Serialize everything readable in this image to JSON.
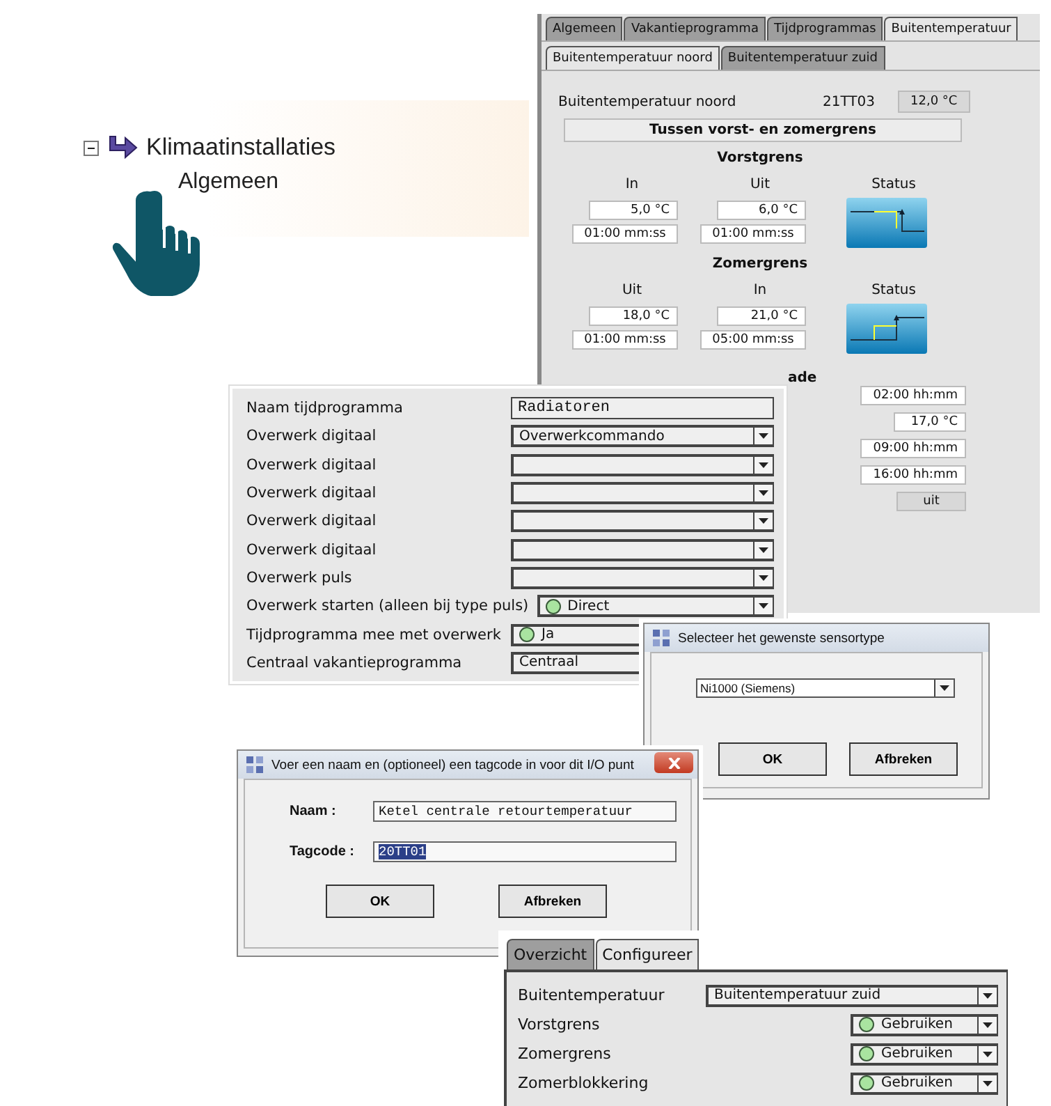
{
  "tree": {
    "items": [
      {
        "label": "Klimaatinstallaties",
        "expanded": true,
        "children": [
          {
            "label": "Algemeen"
          }
        ]
      }
    ]
  },
  "outdoor_panel": {
    "tabs": [
      {
        "label": "Algemeen",
        "selected": false
      },
      {
        "label": "Vakantieprogramma",
        "selected": false
      },
      {
        "label": "Tijdprogrammas",
        "selected": false
      },
      {
        "label": "Buitentemperatuur",
        "selected": true
      }
    ],
    "subtabs": [
      {
        "label": "Buitentemperatuur noord",
        "selected": true
      },
      {
        "label": "Buitentemperatuur zuid",
        "selected": false
      }
    ],
    "sensor": {
      "label": "Buitentemperatuur noord",
      "tag": "21TT03",
      "value": "12,0 °C"
    },
    "state": "Tussen vorst- en zomergrens",
    "sections": [
      {
        "title": "Vorstgrens",
        "status": {
          "heading": "Status",
          "kind": "falling"
        },
        "columns": [
          {
            "heading": "In",
            "value": "5,0 °C",
            "delay": "01:00 mm:ss"
          },
          {
            "heading": "Uit",
            "value": "6,0 °C",
            "delay": "01:00 mm:ss"
          }
        ]
      },
      {
        "title": "Zomergrens",
        "status": {
          "heading": "Status",
          "kind": "rising"
        },
        "columns": [
          {
            "heading": "Uit",
            "value": "18,0 °C",
            "delay": "01:00 mm:ss"
          },
          {
            "heading": "In",
            "value": "21,0 °C",
            "delay": "05:00 mm:ss"
          }
        ]
      }
    ],
    "partial_heading": "ade",
    "extra_values": [
      {
        "text": "02:00 hh:mm",
        "kind": "field"
      },
      {
        "text": "17,0 °C",
        "kind": "short"
      },
      {
        "text": "09:00 hh:mm",
        "kind": "field"
      },
      {
        "text": "16:00 hh:mm",
        "kind": "field"
      },
      {
        "text": "uit",
        "kind": "button"
      }
    ]
  },
  "schedule_form": {
    "rows": [
      {
        "label": "Naam tijdprogramma",
        "kind": "text",
        "value": "Radiatoren"
      },
      {
        "label": "Overwerk digitaal",
        "kind": "select",
        "value": "Overwerkcommando"
      },
      {
        "label": "Overwerk digitaal",
        "kind": "select"
      },
      {
        "label": "Overwerk digitaal",
        "kind": "select"
      },
      {
        "label": "Overwerk digitaal",
        "kind": "select"
      },
      {
        "label": "Overwerk digitaal",
        "kind": "select"
      },
      {
        "label": "Overwerk puls",
        "kind": "select"
      },
      {
        "label": "Overwerk starten (alleen bij type puls)",
        "kind": "select",
        "value": "Direct",
        "indicator": true
      },
      {
        "label": "Tijdprogramma mee met overwerk",
        "kind": "partial",
        "value": "Ja",
        "indicator": true
      },
      {
        "label": "Centraal vakantieprogramma",
        "kind": "partial",
        "value": "Centraal"
      }
    ]
  },
  "sensor_dialog": {
    "title": "Selecteer het gewenste sensortype",
    "value": "Ni1000 (Siemens)",
    "buttons": [
      "OK",
      "Afbreken"
    ]
  },
  "name_dialog": {
    "title": "Voer een naam en (optioneel) een tagcode in voor dit I/O punt",
    "fields": [
      {
        "label": "Naam :",
        "value": "Ketel centrale retourtemperatuur",
        "selected": false
      },
      {
        "label": "Tagcode :",
        "value": "20TT01",
        "selected": true
      }
    ],
    "buttons": [
      "OK",
      "Afbreken"
    ]
  },
  "config_panel": {
    "tabs": [
      {
        "label": "Overzicht",
        "selected": false
      },
      {
        "label": "Configureer",
        "selected": true
      }
    ],
    "rows": [
      {
        "label": "Buitentemperatuur",
        "kind": "wide",
        "value": "Buitentemperatuur zuid"
      },
      {
        "label": "Vorstgrens",
        "kind": "narrow",
        "value": "Gebruiken",
        "indicator": true
      },
      {
        "label": "Zomergrens",
        "kind": "narrow",
        "value": "Gebruiken",
        "indicator": true
      },
      {
        "label": "Zomerblokkering",
        "kind": "narrow",
        "value": "Gebruiken",
        "indicator": true
      }
    ]
  }
}
